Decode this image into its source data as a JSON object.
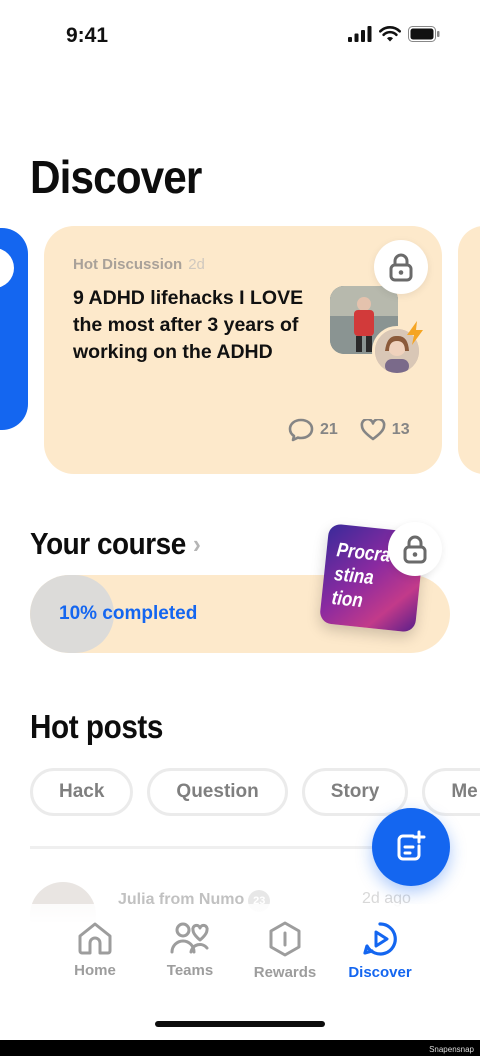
{
  "status_bar": {
    "time": "9:41"
  },
  "page": {
    "title": "Discover"
  },
  "featured_card": {
    "tag": "Hot Discussion",
    "age": "2d",
    "title": "9 ADHD lifehacks I LOVE the most after 3 years of working on the ADHD",
    "comments": "21",
    "likes": "13"
  },
  "course": {
    "section_title": "Your course",
    "chevron": "›",
    "progress_text": "10% completed",
    "progress_fraction": 0.2,
    "cover_text": "Procra stina tion"
  },
  "hot_posts": {
    "section_title": "Hot posts",
    "chips": [
      "Hack",
      "Question",
      "Story",
      "Me"
    ],
    "preview": {
      "author": "Julia from Numo",
      "level": "23",
      "time": "2d ago"
    }
  },
  "tabs": [
    {
      "label": "Home",
      "icon": "home-icon",
      "active": false
    },
    {
      "label": "Teams",
      "icon": "teams-icon",
      "active": false
    },
    {
      "label": "Rewards",
      "icon": "rewards-icon",
      "active": false
    },
    {
      "label": "Discover",
      "icon": "discover-icon",
      "active": true
    }
  ],
  "colors": {
    "accent": "#1466f0",
    "card_bg": "#fde9cb",
    "bolt": "#f5a524"
  },
  "watermark": "Snapensnap"
}
